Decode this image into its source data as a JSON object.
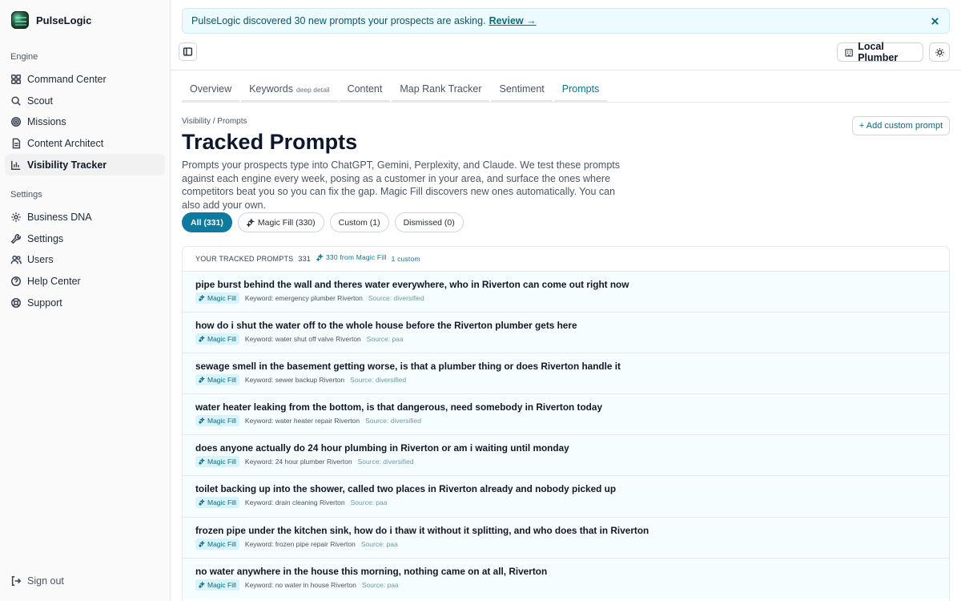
{
  "brand": {
    "name": "PulseLogic"
  },
  "sidebar": {
    "engine_label": "Engine",
    "engine_items": [
      {
        "label": "Command Center",
        "icon": "grid-icon"
      },
      {
        "label": "Scout",
        "icon": "search-icon"
      },
      {
        "label": "Missions",
        "icon": "target-icon"
      },
      {
        "label": "Content Architect",
        "icon": "document-icon"
      },
      {
        "label": "Visibility Tracker",
        "icon": "bar-chart-icon",
        "active": true
      }
    ],
    "settings_label": "Settings",
    "settings_items": [
      {
        "label": "Business DNA",
        "icon": "gear-icon"
      },
      {
        "label": "Settings",
        "icon": "wrench-icon"
      },
      {
        "label": "Users",
        "icon": "users-icon"
      },
      {
        "label": "Help Center",
        "icon": "help-circle-icon"
      },
      {
        "label": "Support",
        "icon": "lifebuoy-icon"
      }
    ],
    "signout": "Sign out"
  },
  "banner": {
    "text": "PulseLogic discovered 30 new prompts your prospects are asking.",
    "link": "Review →"
  },
  "topbar": {
    "business": "Local Plumber"
  },
  "tabs": [
    {
      "label": "Overview",
      "sub": ""
    },
    {
      "label": "Keywords",
      "sub": "deep detail"
    },
    {
      "label": "Content",
      "sub": ""
    },
    {
      "label": "Map Rank Tracker",
      "sub": ""
    },
    {
      "label": "Sentiment",
      "sub": ""
    },
    {
      "label": "Prompts",
      "sub": "",
      "active": true
    }
  ],
  "page": {
    "breadcrumb": "Visibility / Prompts",
    "title": "Tracked Prompts",
    "description": "Prompts your prospects type into ChatGPT, Gemini, Perplexity, and Claude. We test these prompts against each engine every week, posing as a customer in your area, and surface the ones where competitors beat you so you can fix the gap. Magic Fill discovers new ones automatically. You can also add your own.",
    "add_button": "+ Add custom prompt"
  },
  "filters": {
    "all": "All (331)",
    "magic": "Magic Fill (330)",
    "custom": "Custom (1)",
    "dismissed": "Dismissed (0)"
  },
  "table": {
    "header": "YOUR TRACKED PROMPTS",
    "count": "331",
    "magic_count": "330 from Magic Fill",
    "custom_count": "1 custom",
    "badge": "Magic Fill",
    "rows": [
      {
        "text": "pipe burst behind the wall and theres water everywhere, who in Riverton can come out right now",
        "keyword": "Keyword: emergency plumber Riverton",
        "source": "Source: diversified"
      },
      {
        "text": "how do i shut the water off to the whole house before the Riverton plumber gets here",
        "keyword": "Keyword: water shut off valve Riverton",
        "source": "Source: paa"
      },
      {
        "text": "sewage smell in the basement getting worse, is that a plumber thing or does Riverton handle it",
        "keyword": "Keyword: sewer backup Riverton",
        "source": "Source: diversified"
      },
      {
        "text": "water heater leaking from the bottom, is that dangerous, need somebody in Riverton today",
        "keyword": "Keyword: water heater repair Riverton",
        "source": "Source: diversified"
      },
      {
        "text": "does anyone actually do 24 hour plumbing in Riverton or am i waiting until monday",
        "keyword": "Keyword: 24 hour plumber Riverton",
        "source": "Source: diversified"
      },
      {
        "text": "toilet backing up into the shower, called two places in Riverton already and nobody picked up",
        "keyword": "Keyword: drain cleaning Riverton",
        "source": "Source: paa"
      },
      {
        "text": "frozen pipe under the kitchen sink, how do i thaw it without it splitting, and who does that in Riverton",
        "keyword": "Keyword: frozen pipe repair Riverton",
        "source": "Source: paa"
      },
      {
        "text": "no water anywhere in the house this morning, nothing came on at all, Riverton",
        "keyword": "Keyword: no water in house Riverton",
        "source": "Source: paa"
      }
    ]
  }
}
